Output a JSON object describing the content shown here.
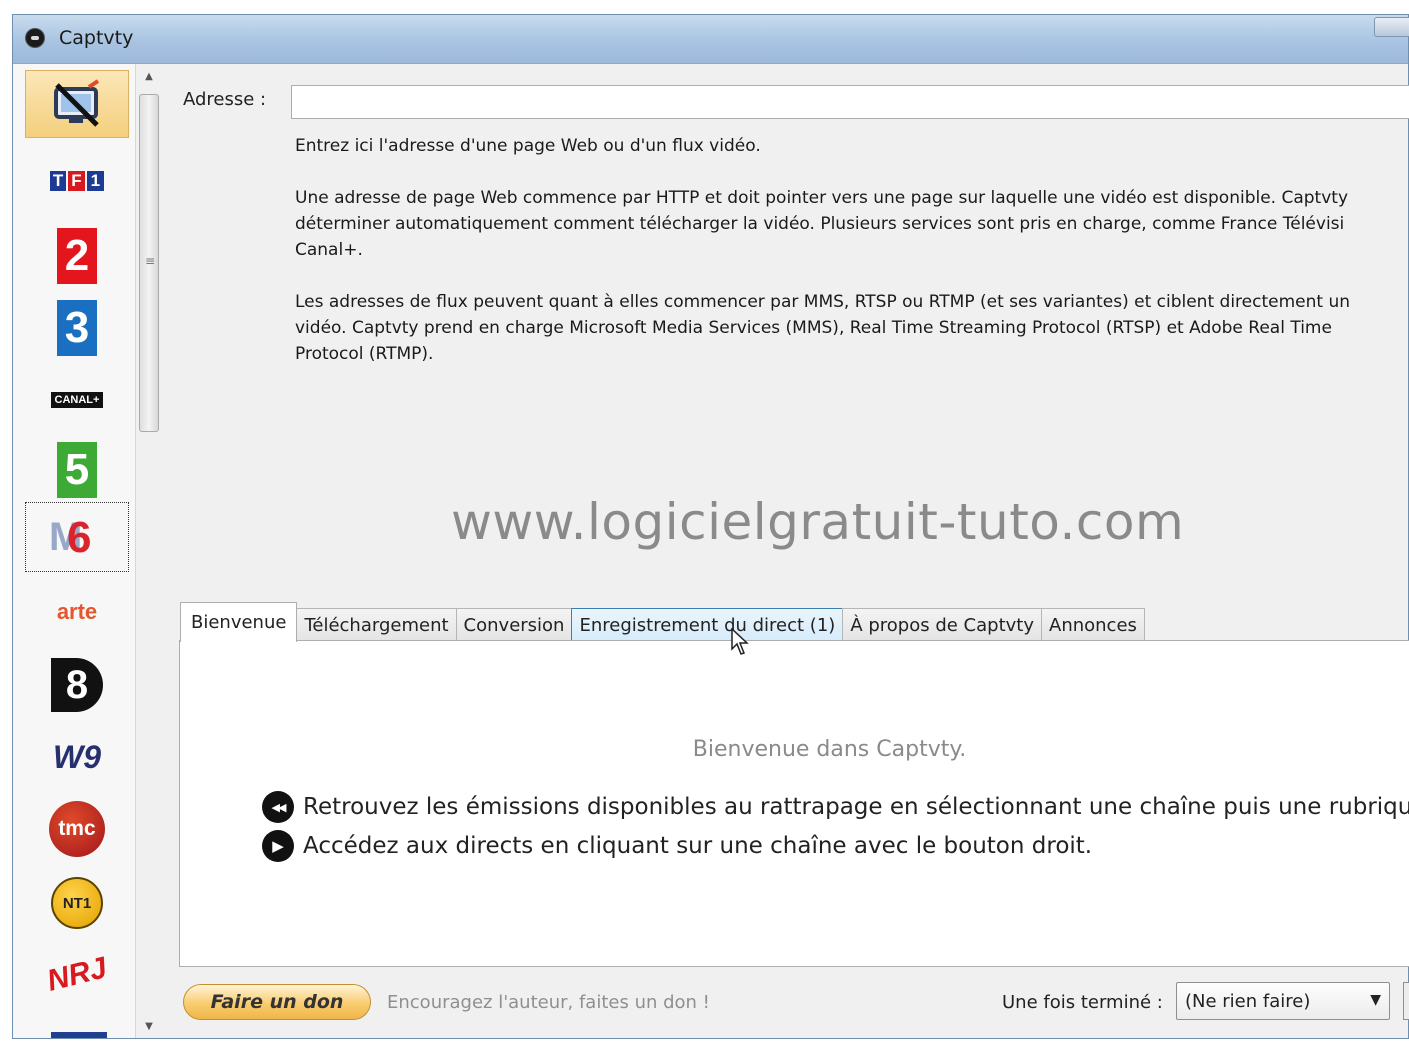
{
  "window": {
    "title": "Captvty"
  },
  "channels": [
    {
      "name": "Adresse",
      "icon": "address-tv-icon"
    },
    {
      "name": "TF1",
      "text": "TF1",
      "icon": "tf1-logo"
    },
    {
      "name": "France 2",
      "text": "2",
      "icon": "france2-logo"
    },
    {
      "name": "France 3",
      "text": "3",
      "icon": "france3-logo"
    },
    {
      "name": "Canal+",
      "text": "CANAL+",
      "icon": "canalplus-logo"
    },
    {
      "name": "France 5",
      "text": "5",
      "icon": "france5-logo"
    },
    {
      "name": "M6",
      "text": "6",
      "icon": "m6-logo"
    },
    {
      "name": "Arte",
      "text": "arte",
      "icon": "arte-logo"
    },
    {
      "name": "D8",
      "text": "8",
      "icon": "d8-logo"
    },
    {
      "name": "W9",
      "text": "W9",
      "icon": "w9-logo"
    },
    {
      "name": "TMC",
      "text": "tmc",
      "icon": "tmc-logo"
    },
    {
      "name": "NT1",
      "text": "NT1",
      "icon": "nt1-logo"
    },
    {
      "name": "NRJ12",
      "text": "NRJ",
      "icon": "nrj12-logo"
    }
  ],
  "address": {
    "label": "Adresse :",
    "value": "",
    "help": [
      "Entrez ici l'adresse d'une page Web ou d'un flux vidéo.",
      "Une adresse de page Web commence par HTTP et doit pointer vers une page sur laquelle une vidéo est disponible. Captvty\ndéterminer automatiquement comment télécharger la vidéo. Plusieurs services sont pris en charge, comme France Télévisi\nCanal+.",
      "Les adresses de flux peuvent quant à elles commencer par MMS, RTSP ou RTMP (et ses variantes) et ciblent directement un\nvidéo. Captvty prend en charge Microsoft Media Services (MMS), Real Time Streaming Protocol (RTSP) et Adobe Real Time\nProtocol (RTMP)."
    ]
  },
  "watermark": "www.logicielgratuit-tuto.com",
  "tabs": [
    {
      "label": "Bienvenue",
      "selected": true
    },
    {
      "label": "Téléchargement"
    },
    {
      "label": "Conversion"
    },
    {
      "label": "Enregistrement du direct (1)",
      "hover": true
    },
    {
      "label": "À propos de Captvty"
    },
    {
      "label": "Annonces"
    }
  ],
  "welcome": {
    "title": "Bienvenue dans Captvty.",
    "tips": [
      {
        "icon": "rewind-icon",
        "glyph": "◀◀",
        "text": "Retrouvez les émissions disponibles au rattrapage en sélectionnant une chaîne puis une rubrique."
      },
      {
        "icon": "play-icon",
        "glyph": "▶",
        "text": "Accédez aux directs en cliquant sur une chaîne avec le bouton droit."
      }
    ]
  },
  "footer": {
    "donate_label": "Faire un don",
    "donate_text": "Encouragez l'auteur, faites un don !",
    "after_label": "Une fois terminé :",
    "after_value": "(Ne rien faire)"
  },
  "colors": {
    "accent_blue": "#3c7fb1",
    "donate_orange": "#f8cc6f",
    "titlebar": "#a9c4e2"
  }
}
